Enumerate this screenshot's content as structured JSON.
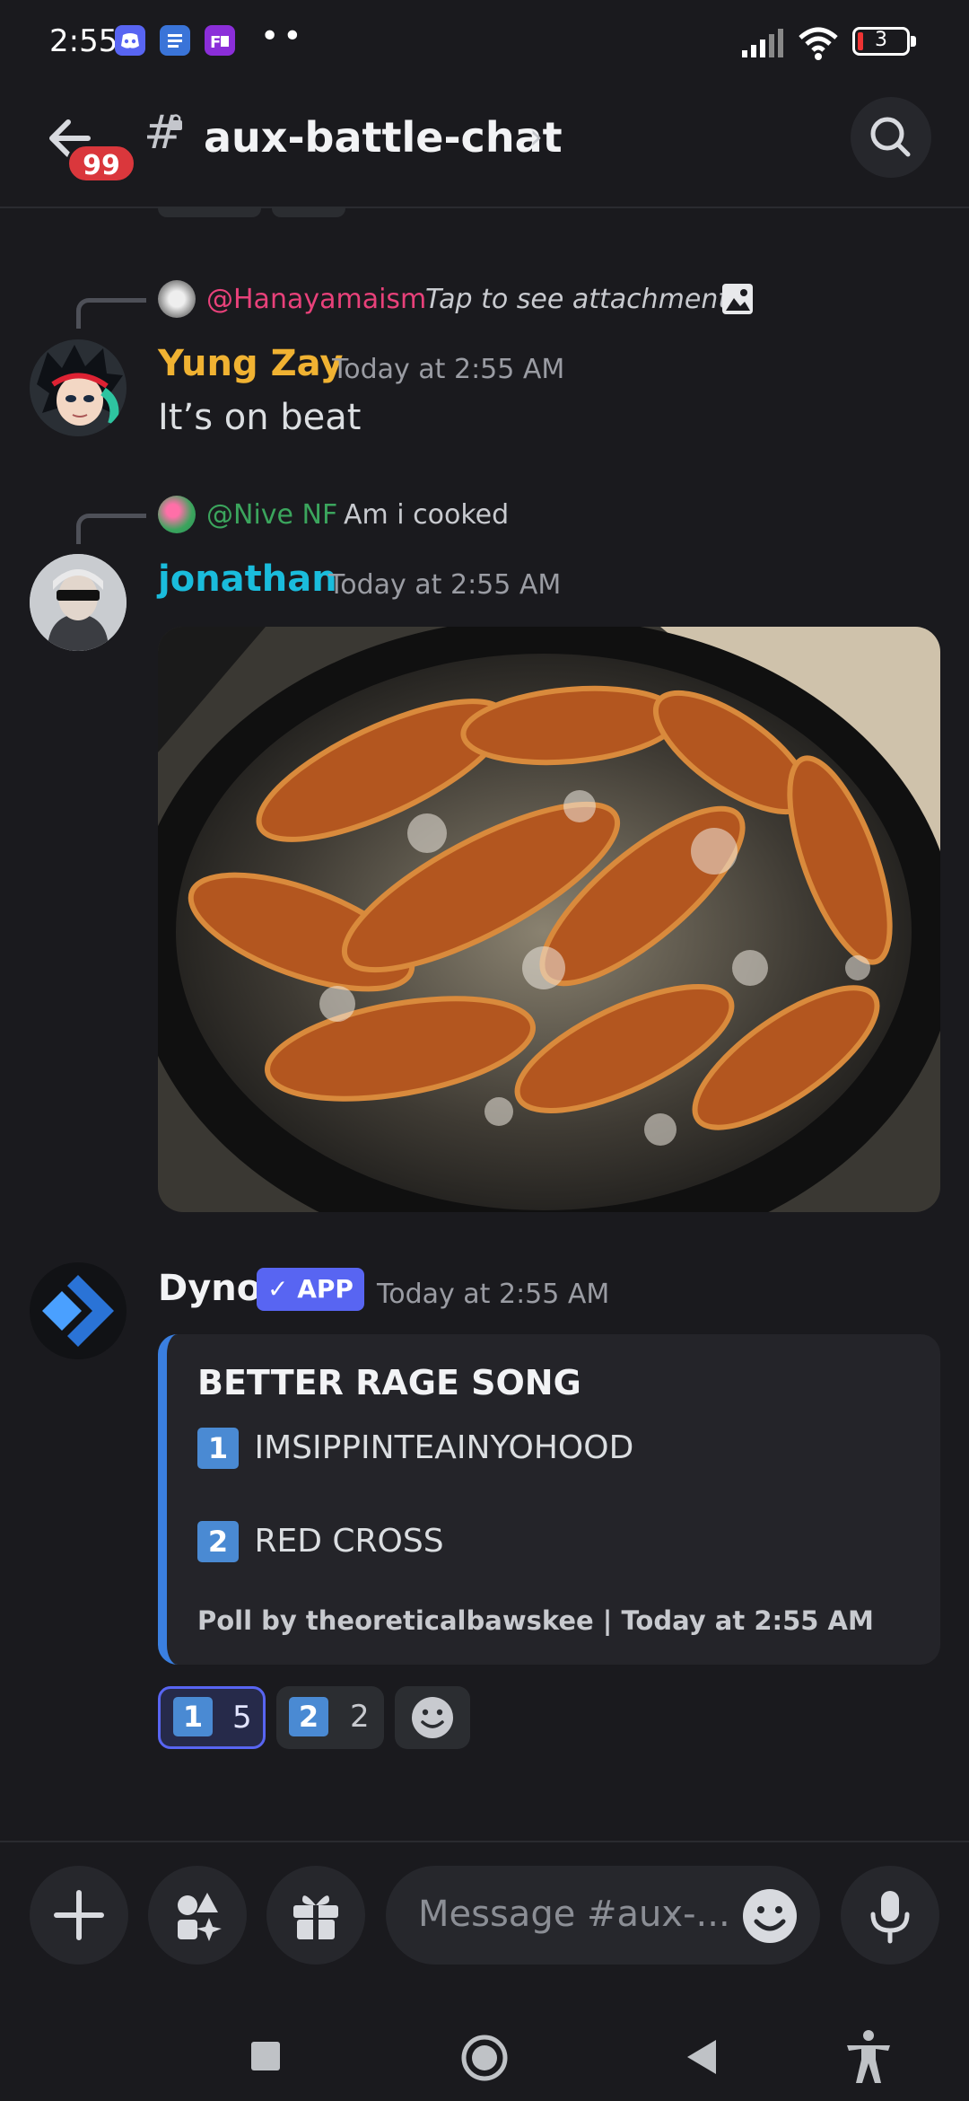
{
  "status_bar": {
    "time": "2:55",
    "battery": "3"
  },
  "header": {
    "unread_badge": "99",
    "channel_name": "aux-battle-chat"
  },
  "messages": [
    {
      "reply": {
        "mention": "@Hanayamaism",
        "text": "Tap to see attachment"
      },
      "author": "Yung Zay",
      "timestamp": "Today at 2:55 AM",
      "text": "It’s on beat",
      "author_color": "#f0b232"
    },
    {
      "reply": {
        "mention": "@Nive NF",
        "text": "Am i cooked"
      },
      "author": "jonathan",
      "timestamp": "Today at 2:55 AM",
      "author_color": "#1abcdc"
    },
    {
      "author": "Dyno",
      "app_badge": "APP",
      "timestamp": "Today at 2:55 AM",
      "embed": {
        "title": "BETTER RAGE SONG",
        "options": [
          {
            "key": "1",
            "label": "IMSIPPINTEAINYOHOOD"
          },
          {
            "key": "2",
            "label": "RED CROSS"
          }
        ],
        "footer": "Poll by theoreticalbawskee | Today at 2:55 AM"
      },
      "reactions": [
        {
          "key": "1",
          "count": "5",
          "selected": true
        },
        {
          "key": "2",
          "count": "2",
          "selected": false
        }
      ]
    }
  ],
  "input": {
    "placeholder": "Message #aux-..."
  },
  "colors": {
    "accent": "#5865f2",
    "embed_bar": "#3a7fe0",
    "mention_pink": "#e8417a",
    "mention_green": "#3ba55d"
  }
}
